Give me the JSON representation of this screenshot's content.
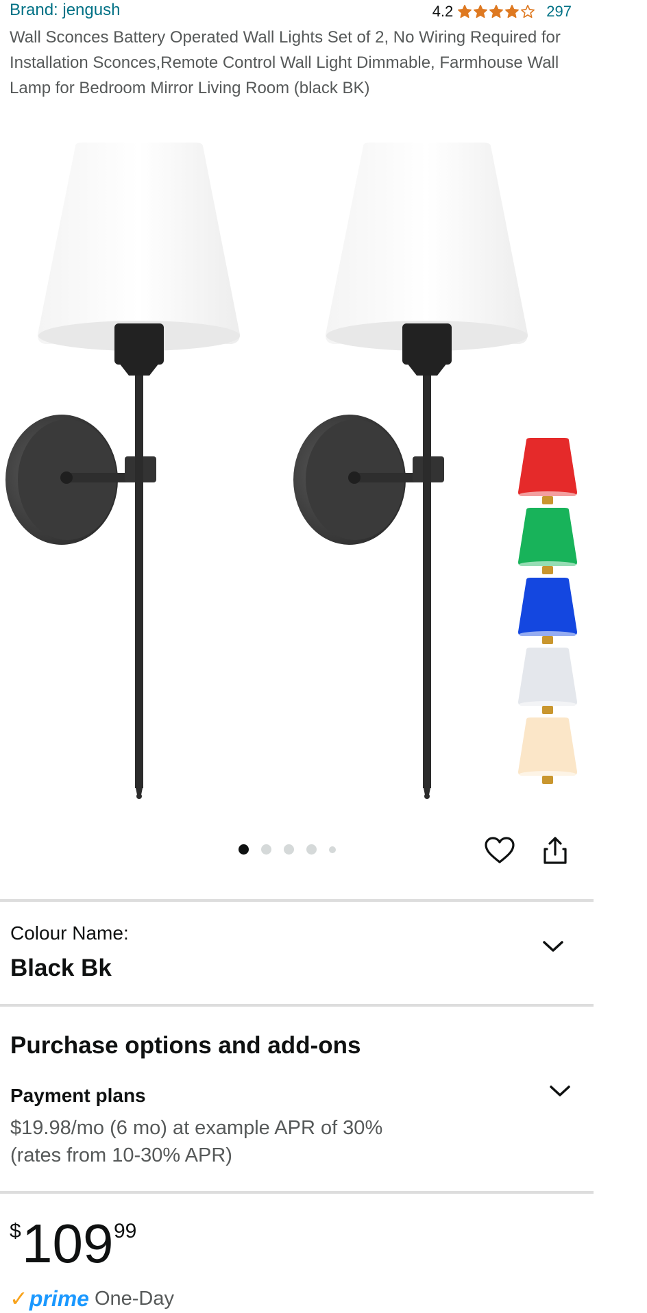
{
  "product": {
    "brand": "Brand: jengush",
    "rating": "4.2",
    "stars": [
      1,
      1,
      1,
      1,
      0
    ],
    "review_count": "297",
    "title": "Wall Sconces Battery Operated Wall Lights Set of 2, No Wiring Required for Installation Sconces,Remote Control Wall Light Dimmable, Farmhouse Wall Lamp for Bedroom Mirror Living Room (black BK)"
  },
  "gallery": {
    "image_count": 5,
    "active_index": 0,
    "shade_colors": [
      "#e52a2a",
      "#18b35a",
      "#1447e0",
      "#e4e7ec",
      "#fbe6c8"
    ]
  },
  "actions": {
    "wishlist_icon": "heart-icon",
    "share_icon": "share-icon"
  },
  "colour": {
    "label": "Colour Name:",
    "value": "Black Bk"
  },
  "purchase": {
    "heading": "Purchase options and add-ons",
    "payment_label": "Payment plans",
    "payment_line1": "$19.98/mo (6 mo) at example APR of 30%",
    "payment_line2": "(rates from 10-30% APR)"
  },
  "price": {
    "symbol": "$",
    "whole": "109",
    "fraction": "99"
  },
  "delivery": {
    "prime_label": "prime",
    "prime_text": "One-Day"
  },
  "colors": {
    "link": "#007185",
    "star": "#de7921",
    "prime_blue": "#1a98ff",
    "prime_check": "#f8a31c"
  }
}
